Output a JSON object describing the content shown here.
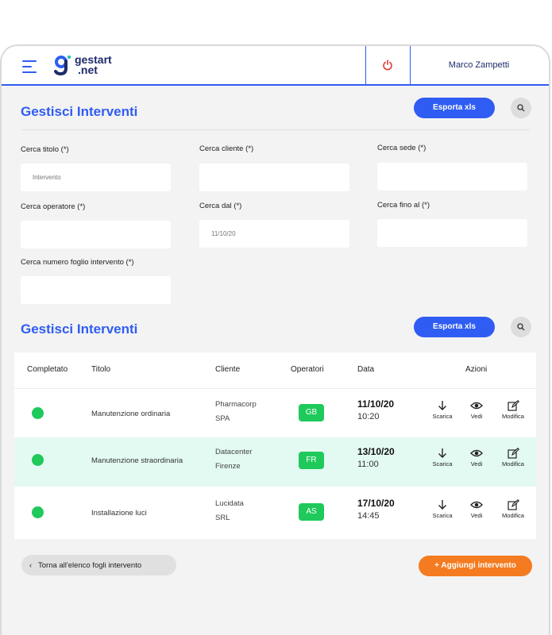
{
  "header": {
    "logo_line1": "gestart",
    "logo_line2": ".net",
    "user_name": "Marco Zampetti"
  },
  "filters": {
    "title": "Gestisci Interventi",
    "export_label": "Esporta xls",
    "fields": {
      "titolo_label": "Cerca titolo (*)",
      "titolo_placeholder": "Intervento",
      "cliente_label": "Cerca cliente (*)",
      "sede_label": "Cerca sede (*)",
      "operatore_label": "Cerca operatore (*)",
      "dal_label": "Cerca dal (*)",
      "dal_placeholder": "11/10/20",
      "fino_label": "Cerca fino al (*)",
      "numero_label": "Cerca numero foglio intervento (*)"
    }
  },
  "list": {
    "title": "Gestisci Interventi",
    "export_label": "Esporta xls",
    "headers": {
      "completato": "Completato",
      "titolo": "Titolo",
      "cliente": "Cliente",
      "operatori": "Operatori",
      "data": "Data",
      "azioni": "Azioni"
    },
    "actions": {
      "scarica": "Scarica",
      "vedi": "Vedi",
      "modifica": "Modifica"
    },
    "rows": [
      {
        "titolo": "Manutenzione ordinaria",
        "cliente1": "Pharmacorp",
        "cliente2": "SPA",
        "operatore": "GB",
        "data": "11/10/20",
        "ora": "10:20"
      },
      {
        "titolo": "Manutenzione straordinaria",
        "cliente1": "Datacenter",
        "cliente2": "Firenze",
        "operatore": "FR",
        "data": "13/10/20",
        "ora": "11:00"
      },
      {
        "titolo": "Installazione luci",
        "cliente1": "Lucidata",
        "cliente2": "SRL",
        "operatore": "AS",
        "data": "17/10/20",
        "ora": "14:45"
      }
    ]
  },
  "footer": {
    "back_label": "Torna all'elenco fogli intervento",
    "back_icon": "chevron-left-icon",
    "add_label": "+ Aggiungi intervento"
  },
  "colors": {
    "primary": "#2f5cf2",
    "success": "#1fc95b",
    "accent": "#f47b20",
    "highlight_row": "#e3faf3"
  }
}
